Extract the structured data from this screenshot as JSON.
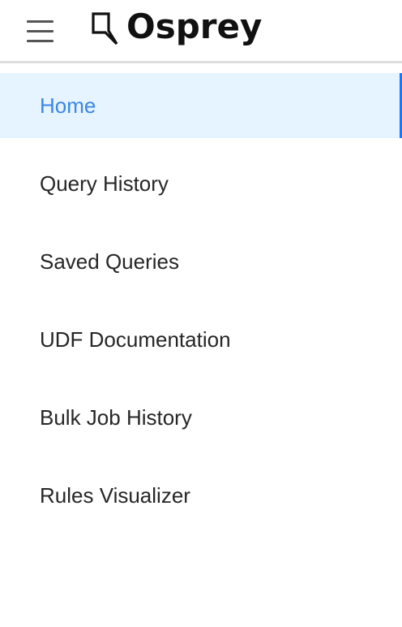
{
  "header": {
    "menu_icon": "hamburger-menu-icon",
    "logo_icon": "osprey-logo-icon",
    "logo_text": "Osprey"
  },
  "nav": {
    "items": [
      {
        "label": "Home",
        "selected": true
      },
      {
        "label": "Query History",
        "selected": false
      },
      {
        "label": "Saved Queries",
        "selected": false
      },
      {
        "label": "UDF Documentation",
        "selected": false
      },
      {
        "label": "Bulk Job History",
        "selected": false
      },
      {
        "label": "Rules Visualizer",
        "selected": false
      }
    ]
  },
  "colors": {
    "selected_background": "#e6f4ff",
    "selected_text": "#3a86e8",
    "selected_indicator": "#1677ff",
    "text": "#262626"
  }
}
